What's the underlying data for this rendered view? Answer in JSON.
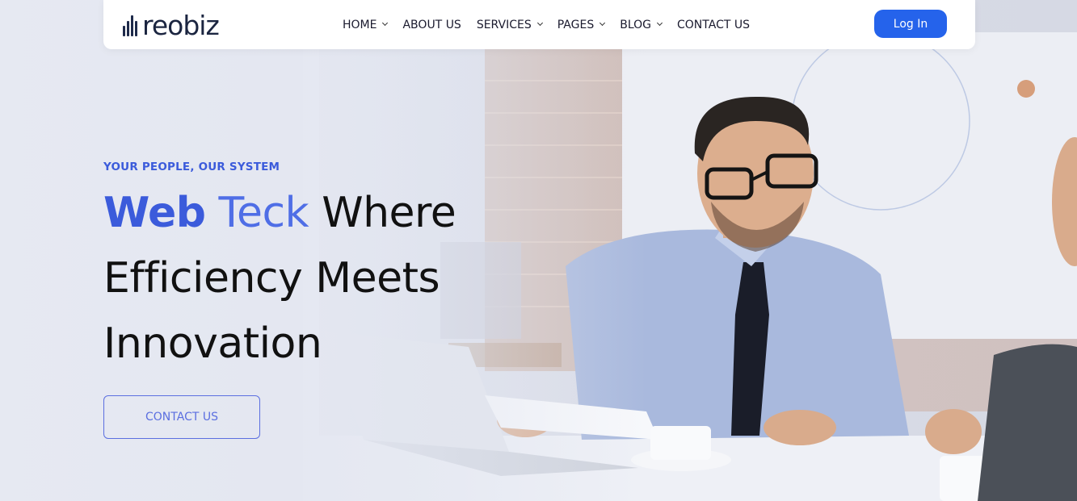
{
  "brand": {
    "name": "reobiz",
    "color": "#1b2540"
  },
  "nav": {
    "items": [
      {
        "label": "HOME",
        "has_dropdown": true
      },
      {
        "label": "ABOUT US",
        "has_dropdown": false
      },
      {
        "label": "SERVICES",
        "has_dropdown": true
      },
      {
        "label": "PAGES",
        "has_dropdown": true
      },
      {
        "label": "BLOG",
        "has_dropdown": true
      },
      {
        "label": "CONTACT US",
        "has_dropdown": false
      }
    ],
    "login_label": "Log In"
  },
  "hero": {
    "eyebrow": "YOUR PEOPLE, OUR SYSTEM",
    "headline_word1": "Web",
    "headline_word2": "Teck",
    "headline_line1_rest": "Where",
    "headline_line2": "Efficiency Meets",
    "headline_line3": "Innovation",
    "cta_label": "CONTACT US",
    "background_image": "business-meeting-photo"
  },
  "colors": {
    "accent": "#2563eb",
    "eyebrow": "#3b5bdb",
    "cta_border": "#5b6fe0"
  }
}
